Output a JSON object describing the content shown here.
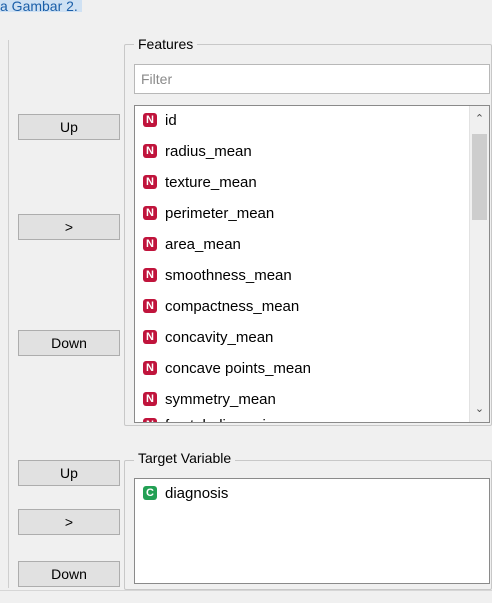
{
  "caption": "a Gambar 2.",
  "colors": {
    "numeric_badge": "#c0143c",
    "categorical_badge": "#23a054"
  },
  "features": {
    "title": "Features",
    "filter_placeholder": "Filter",
    "buttons": {
      "up": "Up",
      "move": ">",
      "down": "Down"
    },
    "items": [
      {
        "type": "N",
        "label": "id"
      },
      {
        "type": "N",
        "label": "radius_mean"
      },
      {
        "type": "N",
        "label": "texture_mean"
      },
      {
        "type": "N",
        "label": "perimeter_mean"
      },
      {
        "type": "N",
        "label": "area_mean"
      },
      {
        "type": "N",
        "label": "smoothness_mean"
      },
      {
        "type": "N",
        "label": "compactness_mean"
      },
      {
        "type": "N",
        "label": "concavity_mean"
      },
      {
        "type": "N",
        "label": "concave points_mean"
      },
      {
        "type": "N",
        "label": "symmetry_mean"
      },
      {
        "type": "N",
        "label": "fractal_dimension_mean"
      }
    ]
  },
  "target": {
    "title": "Target Variable",
    "buttons": {
      "up": "Up",
      "move": ">",
      "down": "Down"
    },
    "items": [
      {
        "type": "C",
        "label": "diagnosis"
      }
    ]
  },
  "scrollbar": {
    "up_icon": "chevron-up-icon",
    "down_icon": "chevron-down-icon"
  }
}
